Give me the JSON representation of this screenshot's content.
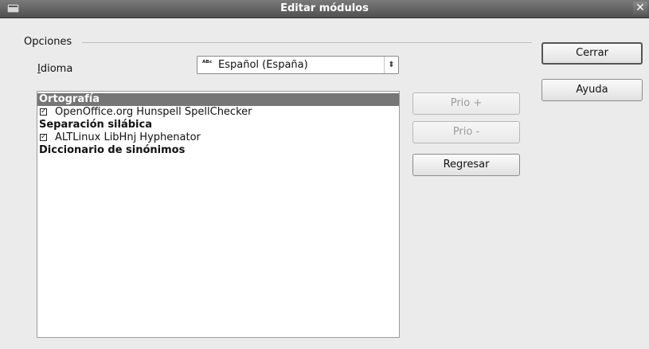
{
  "window": {
    "title": "Editar módulos",
    "close_label": "✕"
  },
  "options": {
    "legend": "Opciones",
    "language_label": "Idioma",
    "language_value": "Español (España)",
    "language_icon_text": "ᴬᴮᶜ"
  },
  "modules": [
    {
      "kind": "selected",
      "text": "Ortografía"
    },
    {
      "kind": "check",
      "checked": true,
      "text": "OpenOffice.org Hunspell SpellChecker"
    },
    {
      "kind": "heading",
      "text": "Separación silábica"
    },
    {
      "kind": "check",
      "checked": true,
      "text": "ALTLinux LibHnj Hyphenator"
    },
    {
      "kind": "heading",
      "text": "Diccionario de sinónimos"
    }
  ],
  "buttons": {
    "prio_up": "Prio +",
    "prio_down": "Prio -",
    "back": "Regresar",
    "close": "Cerrar",
    "help": "Ayuda"
  }
}
